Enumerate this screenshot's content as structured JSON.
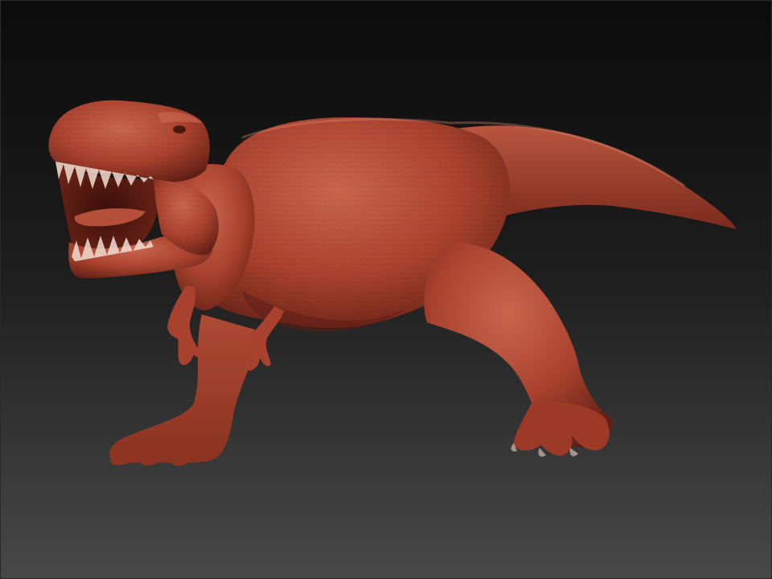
{
  "scene": {
    "subject": "sculpted-dinosaur-model",
    "material_color": "#A8412D",
    "material_highlight": "#C9664E",
    "material_shadow": "#5E1E14",
    "background_top": "#0B0B0B",
    "background_bottom": "#484848"
  }
}
